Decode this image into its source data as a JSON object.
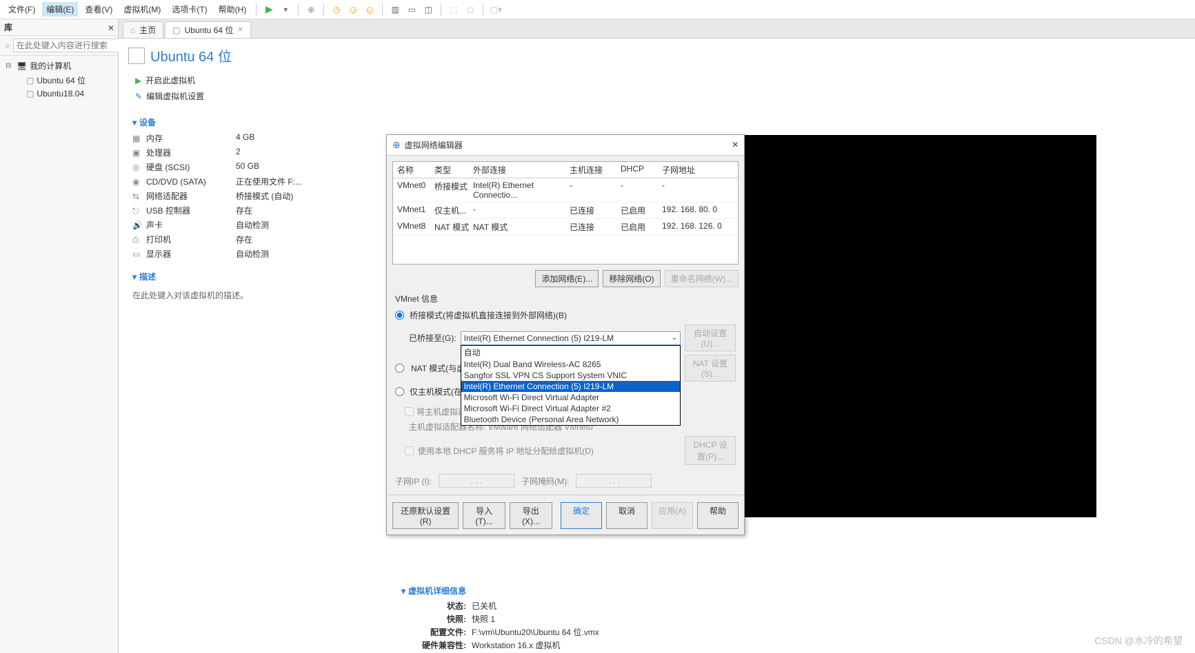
{
  "menu": {
    "file": "文件(F)",
    "edit": "编辑(E)",
    "view": "查看(V)",
    "vm": "虚拟机(M)",
    "tabs": "选项卡(T)",
    "help": "帮助(H)"
  },
  "sidebar": {
    "title": "库",
    "search_placeholder": "在此处键入内容进行搜索",
    "root": "我的计算机",
    "item1": "Ubuntu 64 位",
    "item2": "Ubuntu18.04"
  },
  "tabs": {
    "home": "主页",
    "vm": "Ubuntu 64 位"
  },
  "page_title": "Ubuntu 64 位",
  "actions": {
    "start": "开启此虚拟机",
    "edit_settings": "编辑虚拟机设置"
  },
  "devices": {
    "header": "设备",
    "memory": {
      "label": "内存",
      "value": "4 GB"
    },
    "cpu": {
      "label": "处理器",
      "value": "2"
    },
    "disk": {
      "label": "硬盘 (SCSI)",
      "value": "50 GB"
    },
    "cd": {
      "label": "CD/DVD (SATA)",
      "value": "正在使用文件 F:..."
    },
    "net": {
      "label": "网络适配器",
      "value": "桥接模式 (自动)"
    },
    "usb": {
      "label": "USB 控制器",
      "value": "存在"
    },
    "sound": {
      "label": "声卡",
      "value": "自动检测"
    },
    "printer": {
      "label": "打印机",
      "value": "存在"
    },
    "display": {
      "label": "显示器",
      "value": "自动检测"
    }
  },
  "desc": {
    "header": "描述",
    "placeholder": "在此处键入对该虚拟机的描述。"
  },
  "details": {
    "header": "虚拟机详细信息",
    "state": {
      "label": "状态:",
      "value": "已关机"
    },
    "snapshot": {
      "label": "快照:",
      "value": "快照 1"
    },
    "config": {
      "label": "配置文件:",
      "value": "F:\\vm\\Ubuntu20\\Ubuntu 64 位.vmx"
    },
    "compat": {
      "label": "硬件兼容性:",
      "value": "Workstation 16.x 虚拟机"
    }
  },
  "dialog": {
    "title": "虚拟网络编辑器",
    "headers": {
      "name": "名称",
      "type": "类型",
      "ext": "外部连接",
      "host": "主机连接",
      "dhcp": "DHCP",
      "subnet": "子网地址"
    },
    "rows": [
      {
        "name": "VMnet0",
        "type": "桥接模式",
        "ext": "Intel(R) Ethernet Connectio...",
        "host": "-",
        "dhcp": "-",
        "subnet": "-"
      },
      {
        "name": "VMnet1",
        "type": "仅主机...",
        "ext": "-",
        "host": "已连接",
        "dhcp": "已启用",
        "subnet": "192. 168. 80. 0"
      },
      {
        "name": "VMnet8",
        "type": "NAT 模式",
        "ext": "NAT 模式",
        "host": "已连接",
        "dhcp": "已启用",
        "subnet": "192. 168. 126. 0"
      }
    ],
    "btns": {
      "add": "添加网络(E)...",
      "remove": "移除网络(O)",
      "rename": "重命名网络(W)..."
    },
    "info_header": "VMnet 信息",
    "radio_bridge": "桥接模式(将虚拟机直接连接到外部网络)(B)",
    "bridge_label": "已桥接至(G):",
    "auto_set": "自动设置(U)...",
    "radio_nat": "NAT 模式(与虚拟机共享主机的 IP 地址)(N)",
    "nat_set": "NAT 设置(S)...",
    "radio_host": "仅主机模式(在专用网络内连接虚拟机)(H)",
    "chk_host": "将主机虚拟适配器连接到此网络(V)",
    "host_adapter": "主机虚拟适配器名称: VMware 网络适配器 VMnet0",
    "chk_dhcp": "使用本地 DHCP 服务将 IP 地址分配给虚拟机(D)",
    "dhcp_set": "DHCP 设置(P)...",
    "subnet_ip": "子网IP (I):",
    "subnet_mask": "子网掩码(M):",
    "ip_dots": ".     .     .",
    "combo_value": "Intel(R) Ethernet Connection (5) I219-LM",
    "options": [
      "自动",
      "Intel(R) Dual Band Wireless-AC 8265",
      "Sangfor SSL VPN CS Support System VNIC",
      "Intel(R) Ethernet Connection (5) I219-LM",
      "Microsoft Wi-Fi Direct Virtual Adapter",
      "Microsoft Wi-Fi Direct Virtual Adapter #2",
      "Bluetooth Device (Personal Area Network)"
    ],
    "footer": {
      "restore": "还原默认设置(R)",
      "import": "导入(T)...",
      "export": "导出(X)...",
      "ok": "确定",
      "cancel": "取消",
      "apply": "应用(A)",
      "help": "帮助"
    }
  },
  "watermark": "CSDN @水冷的希望"
}
